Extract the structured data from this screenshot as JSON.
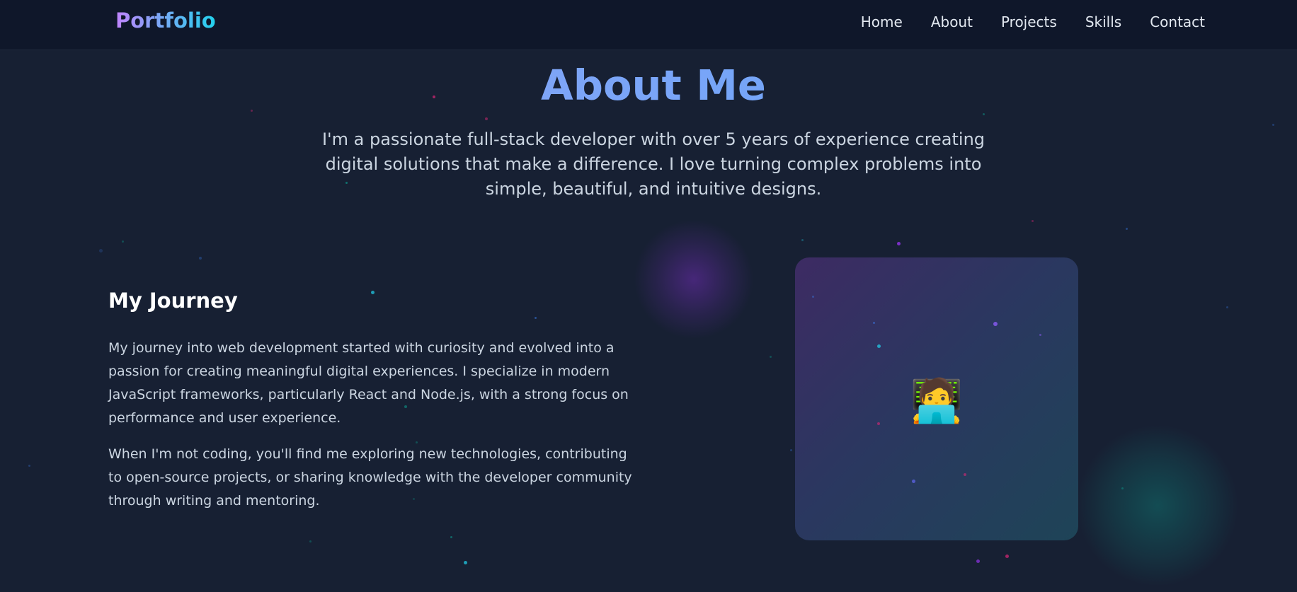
{
  "nav": {
    "brand": "Portfolio",
    "links": [
      "Home",
      "About",
      "Projects",
      "Skills",
      "Contact"
    ]
  },
  "about": {
    "title": "About Me",
    "intro": "I'm a passionate full-stack developer with over 5 years of experience creating digital solutions that make a difference. I love turning complex problems into simple, beautiful, and intuitive designs."
  },
  "journey": {
    "title": "My Journey",
    "paragraphs": [
      "My journey into web development started with curiosity and evolved into a passion for creating meaningful digital experiences. I specialize in modern JavaScript frameworks, particularly React and Node.js, with a strong focus on performance and user experience.",
      "When I'm not coding, you'll find me exploring new technologies, contributing to open-source projects, or sharing knowledge with the developer community through writing and mentoring."
    ]
  },
  "profile_card": {
    "emoji": "🧑‍💻",
    "icon": "developer-emoji"
  },
  "colors": {
    "background": "#172033",
    "navbar": "#0f172a",
    "brand_gradient_start": "#c084fc",
    "brand_gradient_end": "#22d3ee",
    "title_gradient_start": "#93a5f5",
    "title_gradient_end": "#60a5fa"
  }
}
